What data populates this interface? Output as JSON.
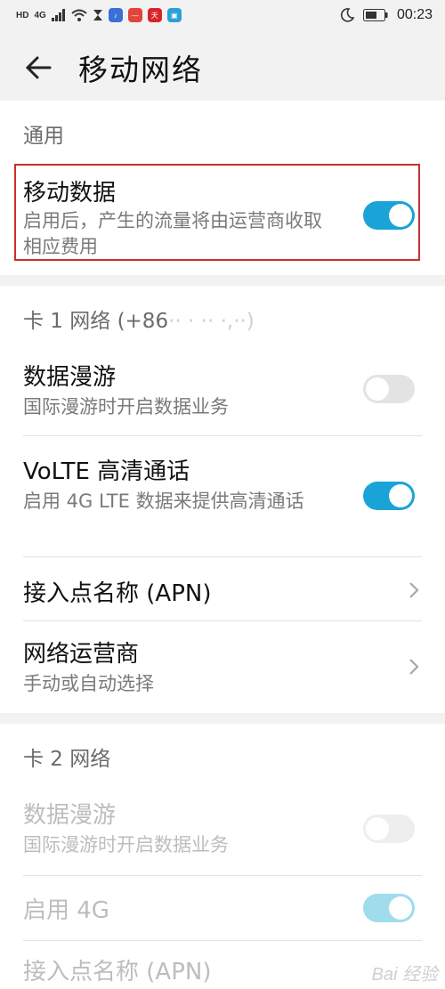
{
  "status_bar": {
    "left_tags": [
      "HD",
      "4G"
    ],
    "apps": [
      {
        "name": "music-app-icon",
        "color": "#3a6fd8",
        "glyph": "♪"
      },
      {
        "name": "red-app-icon",
        "color": "#e0443a",
        "glyph": "—"
      },
      {
        "name": "tmall-app-icon",
        "color": "#d9232b",
        "glyph": "天猫"
      },
      {
        "name": "teal-app-icon",
        "color": "#2aa0d8",
        "glyph": "▣"
      }
    ],
    "time": "00:23"
  },
  "header": {
    "back_icon": "arrow-left-icon",
    "title": "移动网络"
  },
  "general": {
    "heading": "通用",
    "mobile_data": {
      "title": "移动数据",
      "subtitle": "启用后，产生的流量将由运营商收取相应费用",
      "toggle": "on"
    }
  },
  "sim1": {
    "heading": "卡 1 网络 (+86",
    "rows": {
      "roaming": {
        "title": "数据漫游",
        "subtitle": "国际漫游时开启数据业务",
        "toggle": "off"
      },
      "volte": {
        "title": "VoLTE 高清通话",
        "subtitle": "启用 4G LTE 数据来提供高清通话",
        "toggle": "on"
      },
      "apn": {
        "title": "接入点名称 (APN)"
      },
      "operator": {
        "title": "网络运营商",
        "subtitle": "手动或自动选择"
      }
    }
  },
  "sim2": {
    "heading": "卡 2 网络",
    "rows": {
      "roaming": {
        "title": "数据漫游",
        "subtitle": "国际漫游时开启数据业务",
        "toggle": "off"
      },
      "enable4g": {
        "title": "启用 4G",
        "toggle": "on"
      },
      "apn": {
        "title": "接入点名称 (APN)"
      }
    }
  },
  "watermark": "Bai 经验",
  "colors": {
    "accent": "#1aa3d6",
    "highlight": "#c9302c"
  }
}
